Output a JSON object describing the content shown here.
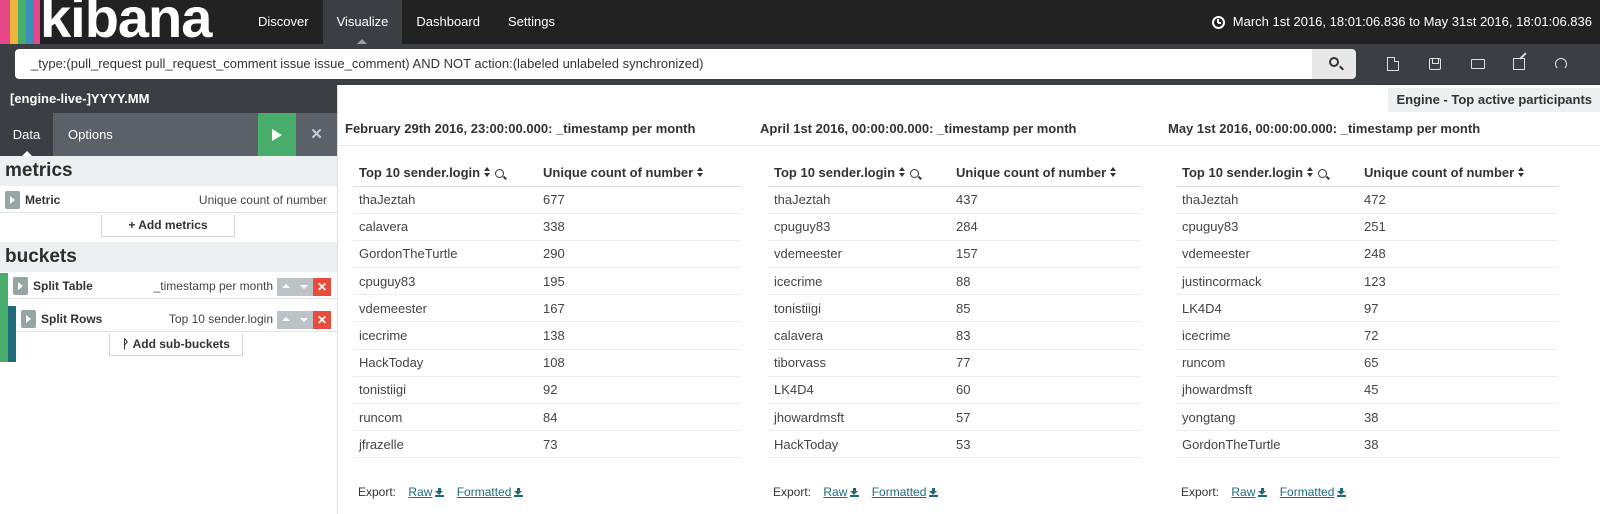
{
  "app": {
    "logo_text": "kibana",
    "nav": [
      "Discover",
      "Visualize",
      "Dashboard",
      "Settings"
    ],
    "active_nav": "Visualize",
    "time_range": "March 1st 2016, 18:01:06.836 to May 31st 2016, 18:01:06.836",
    "logo_stripe_colors": [
      "#e8478b",
      "#f0b53c",
      "#48ad6a",
      "#3b8fb8"
    ]
  },
  "search": {
    "query": "_type:(pull_request pull_request_comment issue issue_comment) AND NOT action:(labeled unlabeled synchronized)",
    "toolbar_icons": [
      "new-visualization-icon",
      "save-icon",
      "open-icon",
      "share-icon",
      "refresh-icon"
    ]
  },
  "sidebar": {
    "index_pattern": "[engine-live-]YYYY.MM",
    "tabs": [
      "Data",
      "Options"
    ],
    "metrics_heading": "metrics",
    "metric": {
      "title": "Metric",
      "description": "Unique count of number"
    },
    "add_metrics_label": "Add metrics",
    "buckets_heading": "buckets",
    "split_table": {
      "title": "Split Table",
      "description": "_timestamp per month"
    },
    "split_rows": {
      "title": "Split Rows",
      "description": "Top 10 sender.login"
    },
    "add_sub_buckets_label": "Add sub-buckets",
    "colors": {
      "apply": "#48ad6a",
      "remove": "#e74c3c",
      "bucket_green": "#48ad6a",
      "bucket_teal": "#1f6b7a"
    }
  },
  "main": {
    "vis_title": "Engine - Top active participants",
    "col_login": "Top 10 sender.login",
    "col_count": "Unique count of number",
    "export_label": "Export:",
    "export_raw": "Raw",
    "export_formatted": "Formatted",
    "tables": [
      {
        "heading": "February 29th 2016, 23:00:00.000: _timestamp per month",
        "rows": [
          [
            "thaJeztah",
            "677"
          ],
          [
            "calavera",
            "338"
          ],
          [
            "GordonTheTurtle",
            "290"
          ],
          [
            "cpuguy83",
            "195"
          ],
          [
            "vdemeester",
            "167"
          ],
          [
            "icecrime",
            "138"
          ],
          [
            "HackToday",
            "108"
          ],
          [
            "tonistiigi",
            "92"
          ],
          [
            "runcom",
            "84"
          ],
          [
            "jfrazelle",
            "73"
          ]
        ]
      },
      {
        "heading": "April 1st 2016, 00:00:00.000: _timestamp per month",
        "rows": [
          [
            "thaJeztah",
            "437"
          ],
          [
            "cpuguy83",
            "284"
          ],
          [
            "vdemeester",
            "157"
          ],
          [
            "icecrime",
            "88"
          ],
          [
            "tonistiigi",
            "85"
          ],
          [
            "calavera",
            "83"
          ],
          [
            "tiborvass",
            "77"
          ],
          [
            "LK4D4",
            "60"
          ],
          [
            "jhowardmsft",
            "57"
          ],
          [
            "HackToday",
            "53"
          ]
        ]
      },
      {
        "heading": "May 1st 2016, 00:00:00.000: _timestamp per month",
        "rows": [
          [
            "thaJeztah",
            "472"
          ],
          [
            "cpuguy83",
            "251"
          ],
          [
            "vdemeester",
            "248"
          ],
          [
            "justincormack",
            "123"
          ],
          [
            "LK4D4",
            "97"
          ],
          [
            "icecrime",
            "72"
          ],
          [
            "runcom",
            "65"
          ],
          [
            "jhowardmsft",
            "45"
          ],
          [
            "yongtang",
            "38"
          ],
          [
            "GordonTheTurtle",
            "38"
          ]
        ]
      }
    ]
  }
}
